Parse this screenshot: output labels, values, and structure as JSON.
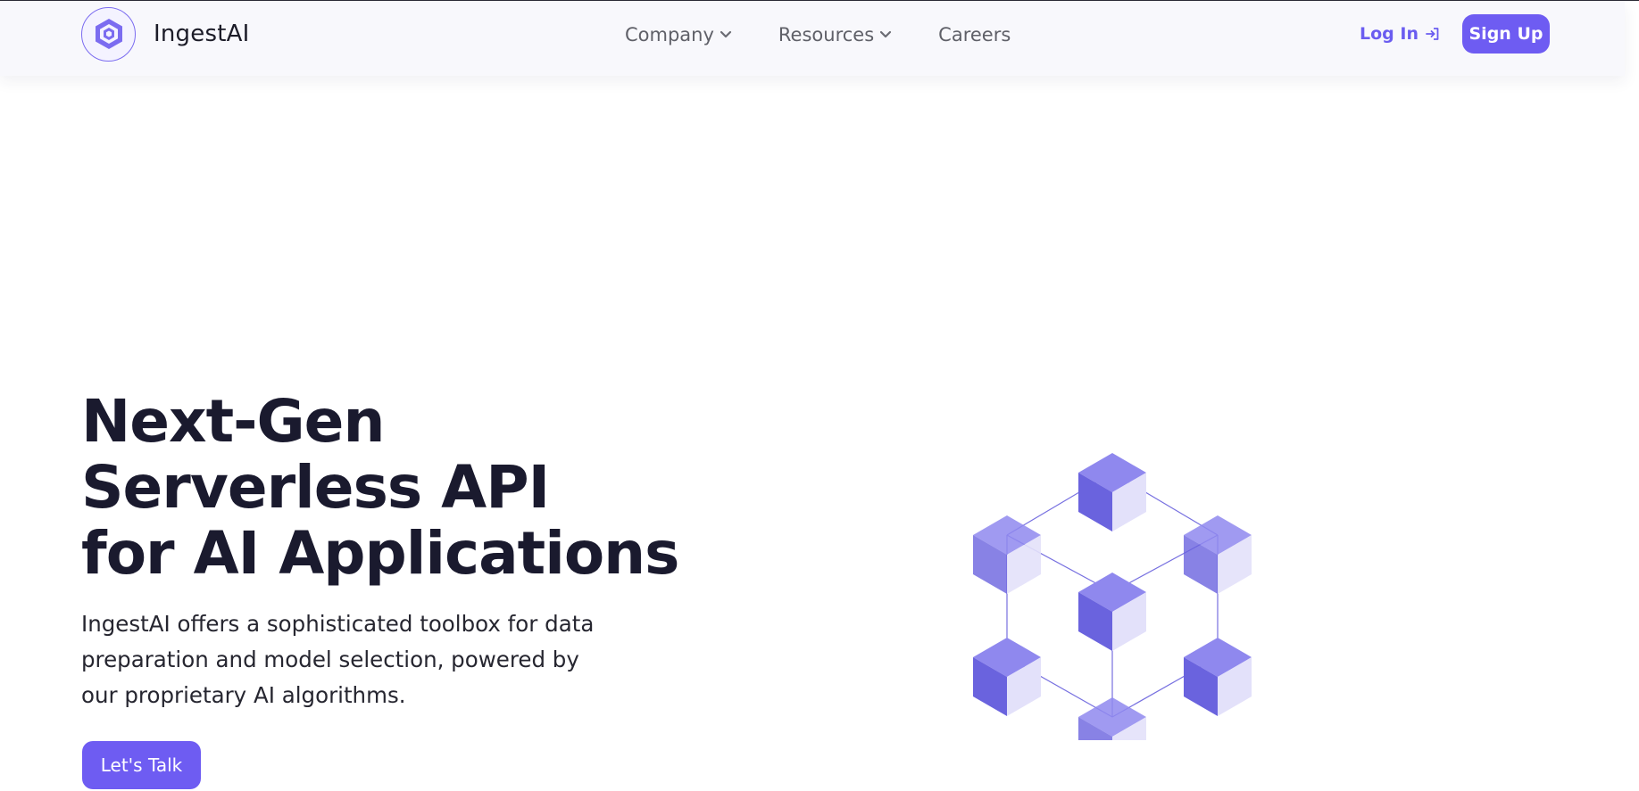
{
  "brand": {
    "name": "IngestAI",
    "logo_icon": "hexagon-logo-icon"
  },
  "nav": {
    "items": [
      {
        "label": "Company",
        "has_dropdown": true
      },
      {
        "label": "Resources",
        "has_dropdown": true
      },
      {
        "label": "Careers",
        "has_dropdown": false
      }
    ]
  },
  "auth": {
    "login_label": "Log In",
    "login_icon": "login-arrow-icon",
    "signup_label": "Sign Up"
  },
  "hero": {
    "title_lines": [
      "Next-Gen",
      "Serverless API",
      "for AI Applications"
    ],
    "description_lines": [
      "IngestAI offers a sophisticated toolbox for data",
      "preparation and model selection, powered by",
      "our proprietary AI algorithms."
    ],
    "cta_label": "Let's Talk",
    "illustration_icon": "cube-network-illustration"
  },
  "colors": {
    "accent": "#6e5cf2",
    "text": "#1a1a2e",
    "nav_text": "#5f6068",
    "navbar_bg": "#f8f8fc"
  }
}
